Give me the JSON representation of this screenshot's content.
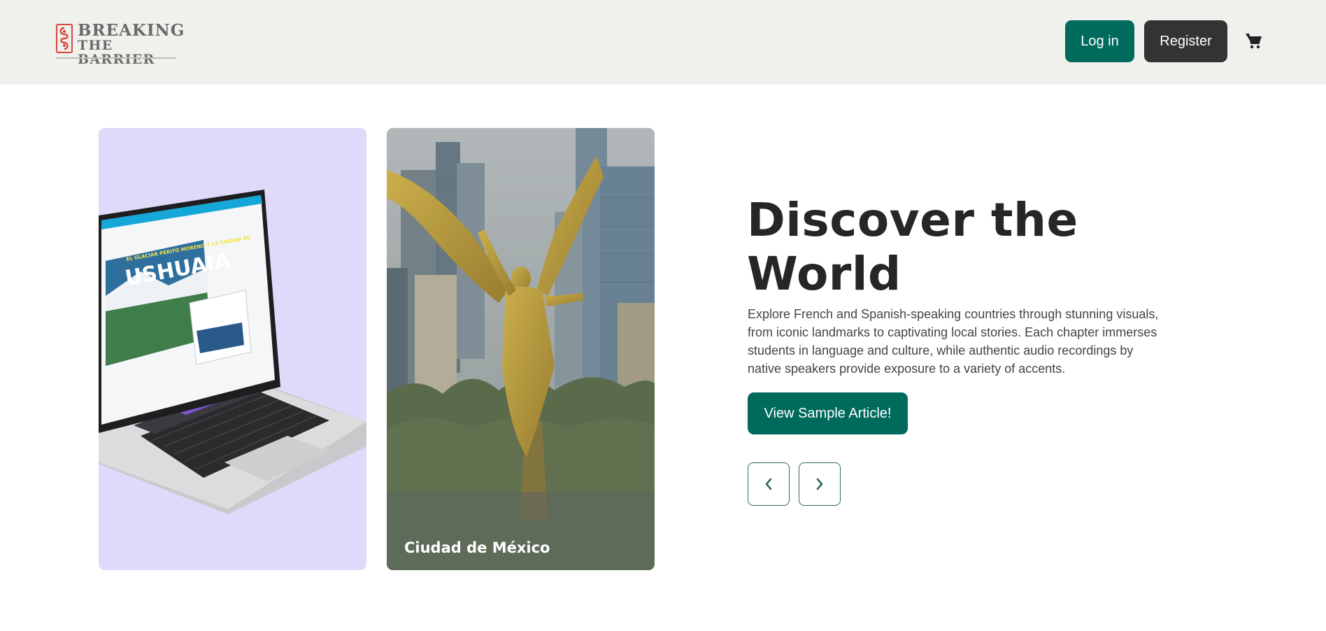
{
  "header": {
    "logo": {
      "line1": "BREAKING",
      "line2": "THE BARRIER"
    },
    "login_label": "Log in",
    "register_label": "Register",
    "cart_icon": "cart-icon"
  },
  "cards": [
    {
      "name": "laptop-preview",
      "caption": "",
      "screen_title": "USHUAIA",
      "screen_subtitle": "EL GLACIAR PERITO MORENO Y LA CIUDAD DE"
    },
    {
      "name": "mexico-city",
      "caption": "Ciudad de México"
    }
  ],
  "hero": {
    "title": "Discover the World",
    "description": "Explore French and Spanish-speaking countries through stunning visuals, from iconic landmarks to captivating local stories. Each chapter immerses students in language and culture, while authentic audio recordings by native speakers provide exposure to a variety of accents.",
    "cta_label": "View Sample Article!",
    "prev_icon": "chevron-left-icon",
    "next_icon": "chevron-right-icon"
  },
  "colors": {
    "primary": "#006a5c",
    "dark": "#333333",
    "header_bg": "#f0f0ed",
    "card_lavender": "#dfd9fa"
  }
}
